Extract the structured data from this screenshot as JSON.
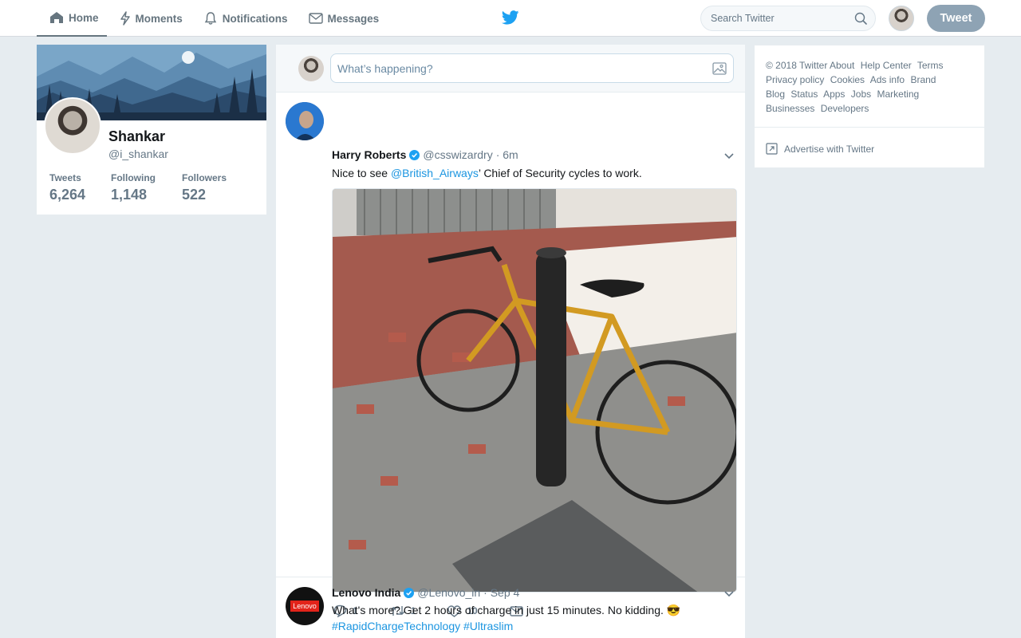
{
  "nav": {
    "home": "Home",
    "moments": "Moments",
    "notifications": "Notifications",
    "messages": "Messages"
  },
  "search": {
    "placeholder": "Search Twitter"
  },
  "tweet_button": "Tweet",
  "profile": {
    "name": "Shankar",
    "handle": "@i_shankar",
    "stats": [
      {
        "label": "Tweets",
        "value": "6,264"
      },
      {
        "label": "Following",
        "value": "1,148"
      },
      {
        "label": "Followers",
        "value": "522"
      }
    ]
  },
  "composer": {
    "placeholder": "What’s happening?"
  },
  "tweets": [
    {
      "name": "Harry Roberts",
      "handle": "@csswizardry",
      "time": "· 6m",
      "text_before": "Nice to see ",
      "mention": "@British_Airways",
      "text_after": "’ Chief of Security cycles to work.",
      "replies": "1",
      "retweets": "1",
      "likes": "10"
    },
    {
      "name": "Lenovo India",
      "handle": "@Lenovo_in",
      "time": "· Sep 4",
      "text": "What's more? Get 2 hours of charge in just 15 minutes. No kidding. 😎",
      "hashtags": "#RapidChargeTechnology #Ultraslim",
      "avatar_text": "Lenovo"
    }
  ],
  "footer": {
    "links": [
      "© 2018 Twitter",
      "About",
      "Help Center",
      "Terms",
      "Privacy policy",
      "Cookies",
      "Ads info",
      "Brand",
      "Blog",
      "Status",
      "Apps",
      "Jobs",
      "Marketing",
      "Businesses",
      "Developers"
    ],
    "advertise": "Advertise with Twitter"
  },
  "colors": {
    "accent": "#1da1f2",
    "link": "#1b95e0",
    "muted": "#657786",
    "background": "#e6ecf0"
  },
  "icons": [
    "home-icon",
    "lightning-icon",
    "bell-icon",
    "envelope-icon",
    "twitter-bird-icon",
    "search-icon",
    "image-icon",
    "verified-icon",
    "chevron-down-icon",
    "reply-icon",
    "retweet-icon",
    "heart-icon",
    "dm-icon",
    "external-link-icon"
  ]
}
